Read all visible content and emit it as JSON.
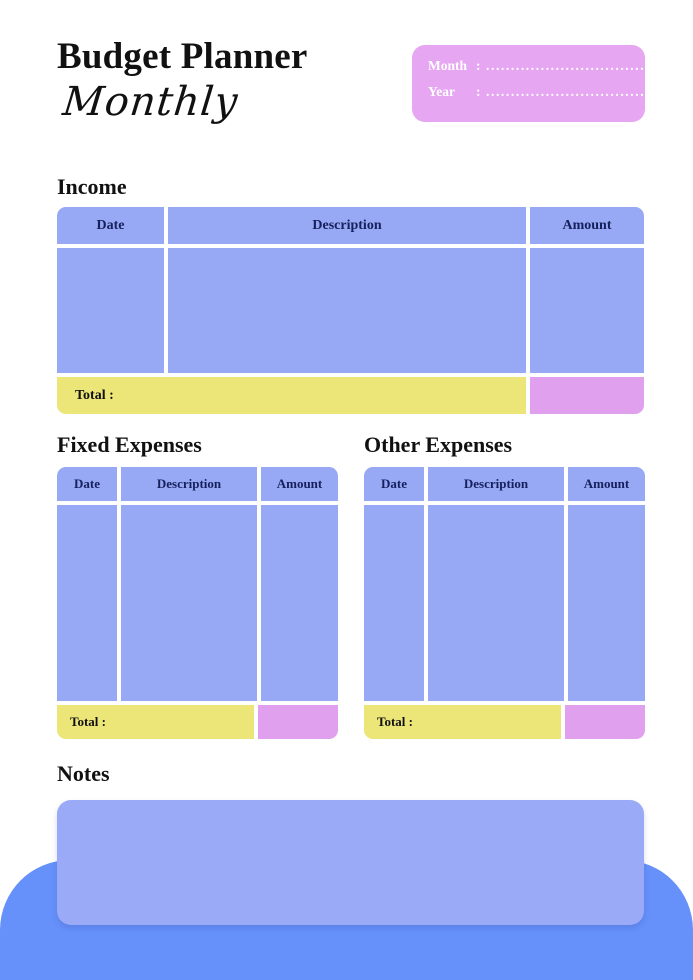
{
  "header": {
    "title_main": "Budget Planner",
    "title_script": "Monthly",
    "meta": {
      "month_label": "Month",
      "year_label": "Year",
      "colon": ":",
      "month_dots": "...................................",
      "year_dots": "...................................",
      "month_value": "",
      "year_value": ""
    }
  },
  "sections": {
    "income": {
      "title": "Income",
      "columns": [
        "Date",
        "Description",
        "Amount"
      ],
      "rows": [],
      "total_label": "Total :",
      "total_value": ""
    },
    "fixed_expenses": {
      "title": "Fixed Expenses",
      "columns": [
        "Date",
        "Description",
        "Amount"
      ],
      "rows": [],
      "total_label": "Total :",
      "total_value": ""
    },
    "other_expenses": {
      "title": "Other Expenses",
      "columns": [
        "Date",
        "Description",
        "Amount"
      ],
      "rows": [],
      "total_label": "Total :",
      "total_value": ""
    },
    "notes": {
      "title": "Notes",
      "value": ""
    }
  },
  "colors": {
    "periwinkle": "#97a8f5",
    "notes_blue": "#9aaaf7",
    "deco_blue": "#6690fa",
    "yellow": "#ece578",
    "pink": "#e0a0ee",
    "header_pink": "#e6a6f2",
    "header_text": "#16205c",
    "ink": "#111111",
    "page_bg": "#ffffff"
  }
}
